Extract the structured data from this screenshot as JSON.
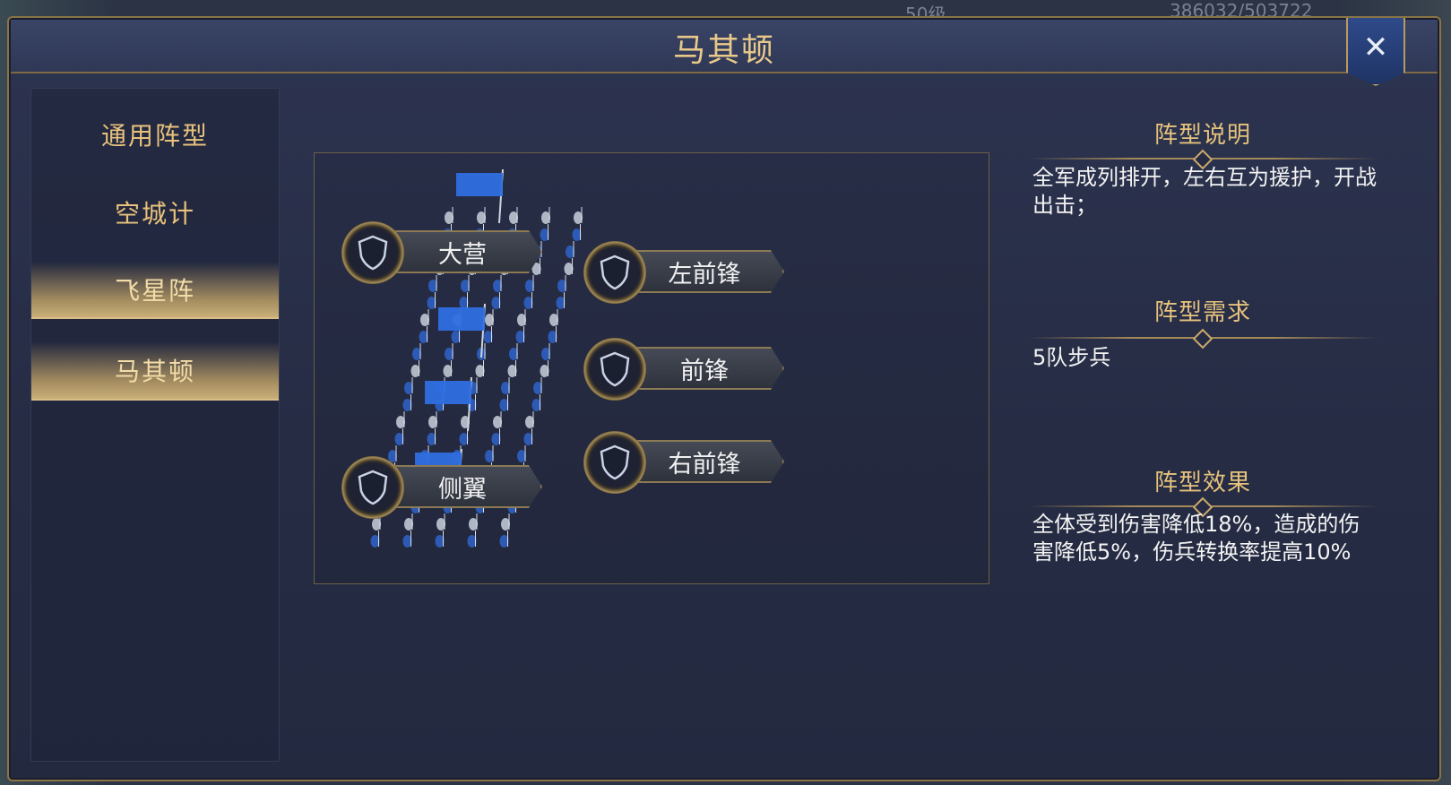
{
  "background": {
    "top_text_left": "50级",
    "top_text_right": "386032/503722"
  },
  "dialog": {
    "title": "马其顿",
    "close_label": "✕"
  },
  "nav": {
    "items": [
      {
        "label": "通用阵型",
        "active": false
      },
      {
        "label": "空城计",
        "active": false
      },
      {
        "label": "飞星阵",
        "active": false
      },
      {
        "label": "马其顿",
        "active": true
      }
    ]
  },
  "formation": {
    "slots": {
      "camp": "大营",
      "left_vanguard": "左前锋",
      "vanguard": "前锋",
      "right_vanguard": "右前锋",
      "flank": "侧翼"
    }
  },
  "info": {
    "description_title": "阵型说明",
    "description_text": "全军成列排开，左右互为援护，开战出击；",
    "requirement_title": "阵型需求",
    "requirement_text": "5队步兵",
    "effect_title": "阵型效果",
    "effect_text": "全体受到伤害降低18%，造成的伤害降低5%，伤兵转换率提高10%"
  },
  "colors": {
    "accent_gold": "#e6c27c",
    "frame_gold": "#8a7446",
    "panel_bg": "#262c44",
    "troop_blue": "#2f63c9"
  }
}
